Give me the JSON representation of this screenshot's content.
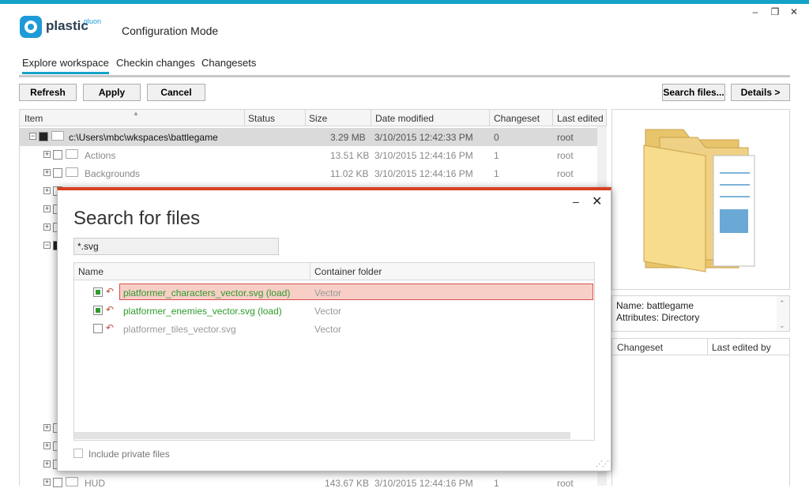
{
  "app": {
    "brand": "plastic",
    "brand_sup": "gluon",
    "mode": "Configuration Mode",
    "window_controls": {
      "minimize": "–",
      "restore": "❐",
      "close": "✕"
    }
  },
  "tabs": [
    {
      "label": "Explore workspace",
      "active": true
    },
    {
      "label": "Checkin changes",
      "active": false
    },
    {
      "label": "Changesets",
      "active": false
    }
  ],
  "toolbar": {
    "refresh": "Refresh",
    "apply": "Apply",
    "cancel": "Cancel",
    "search": "Search files...",
    "details": "Details >"
  },
  "grid": {
    "columns": [
      "Item",
      "Status",
      "Size",
      "Date modified",
      "Changeset",
      "Last edited"
    ],
    "rows": [
      {
        "name": "c:\\Users\\mbc\\wkspaces\\battlegame",
        "status": "",
        "size": "3.29 MB",
        "date": "3/10/2015 12:42:33 PM",
        "changeset": "0",
        "edited": "root"
      },
      {
        "name": "Actions",
        "status": "",
        "size": "13.51 KB",
        "date": "3/10/2015 12:44:16 PM",
        "changeset": "1",
        "edited": "root"
      },
      {
        "name": "Backgrounds",
        "status": "",
        "size": "11.02 KB",
        "date": "3/10/2015 12:44:16 PM",
        "changeset": "1",
        "edited": "root"
      },
      {
        "name": "HUD",
        "status": "",
        "size": "143.67 KB",
        "date": "3/10/2015 12:44:16 PM",
        "changeset": "1",
        "edited": "root"
      }
    ]
  },
  "details": {
    "name_line": "Name: battlegame",
    "attributes_line": "Attributes: Directory",
    "history_columns": [
      "Changeset",
      "Last edited by"
    ]
  },
  "dialog": {
    "title": "Search for files",
    "query": "*.svg",
    "columns": [
      "Name",
      "Container folder"
    ],
    "results": [
      {
        "name": "platformer_characters_vector.svg (load)",
        "folder": "Vector",
        "checked": true
      },
      {
        "name": "platformer_enemies_vector.svg (load)",
        "folder": "Vector",
        "checked": true
      },
      {
        "name": "platformer_tiles_vector.svg",
        "folder": "Vector",
        "checked": false
      }
    ],
    "include_private": "Include private files",
    "minimize": "–",
    "close": "✕"
  },
  "colors": {
    "accent": "#14a3c7",
    "dialog_accent": "#d74120",
    "green": "#2e9b2e",
    "selection": "#f8cfc7"
  }
}
